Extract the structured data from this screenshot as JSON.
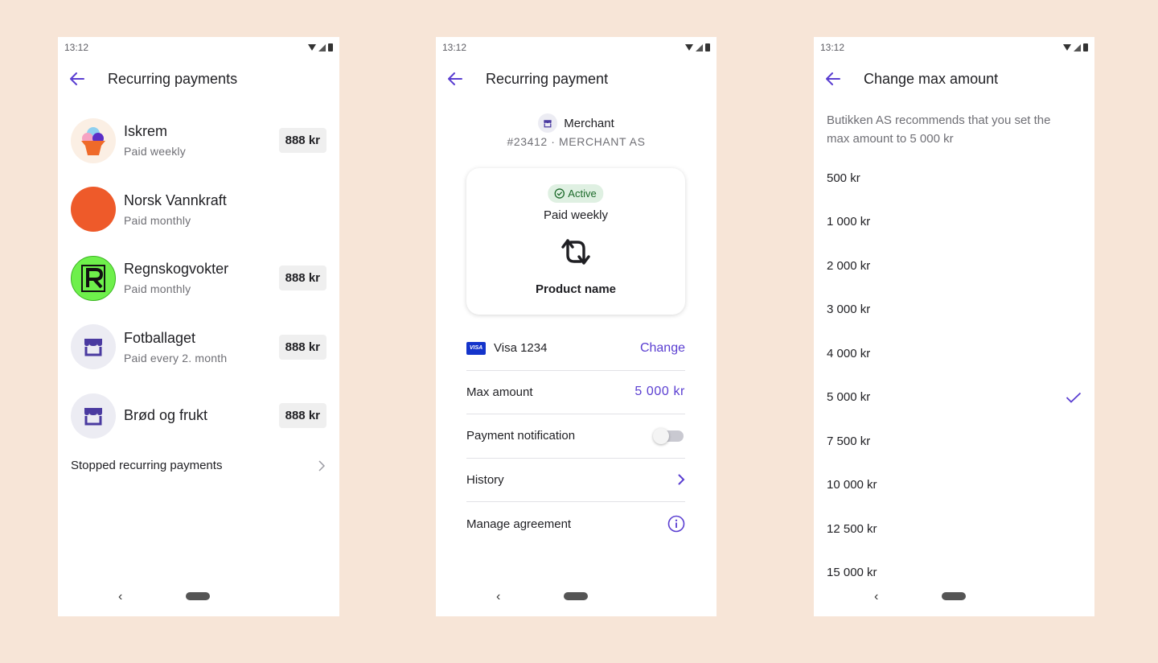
{
  "colors": {
    "background": "#f7e5d7",
    "accent": "#5a3ed1",
    "active_bg": "#dff0e2",
    "active_text": "#1c6a2a"
  },
  "status_bar": {
    "time": "13:12"
  },
  "screen1": {
    "title": "Recurring payments",
    "items": [
      {
        "name": "Iskrem",
        "frequency": "Paid weekly",
        "amount": "888 kr",
        "icon": "ice-cream-icon"
      },
      {
        "name": "Norsk Vannkraft",
        "frequency": "Paid monthly",
        "amount": "",
        "icon": "orange-circle-logo"
      },
      {
        "name": "Regnskogvokter",
        "frequency": "Paid monthly",
        "amount": "888 kr",
        "icon": "r-logo"
      },
      {
        "name": "Fotballaget",
        "frequency": "Paid every 2. month",
        "amount": "888 kr",
        "icon": "store-icon"
      },
      {
        "name": "Brød og frukt",
        "frequency": "",
        "amount": "888 kr",
        "icon": "store-icon"
      }
    ],
    "stopped_label": "Stopped recurring payments"
  },
  "screen2": {
    "title": "Recurring payment",
    "merchant_name": "Merchant",
    "merchant_ref": "#23412 · MERCHANT AS",
    "status": "Active",
    "frequency": "Paid weekly",
    "product_name": "Product name",
    "card_brand": "VISA",
    "card_label": "Visa 1234",
    "change_label": "Change",
    "max_amount_label": "Max amount",
    "max_amount_value": "5 000 kr",
    "notification_label": "Payment notification",
    "notification_enabled": false,
    "history_label": "History",
    "manage_label": "Manage agreement"
  },
  "screen3": {
    "title": "Change max amount",
    "recommendation": "Butikken AS recommends that you set the max amount to 5 000 kr",
    "options": [
      "500 kr",
      "1 000 kr",
      "2 000 kr",
      "3 000 kr",
      "4 000 kr",
      "5 000 kr",
      "7 500 kr",
      "10 000 kr",
      "12 500 kr",
      "15 000 kr"
    ],
    "selected": "5 000 kr"
  }
}
